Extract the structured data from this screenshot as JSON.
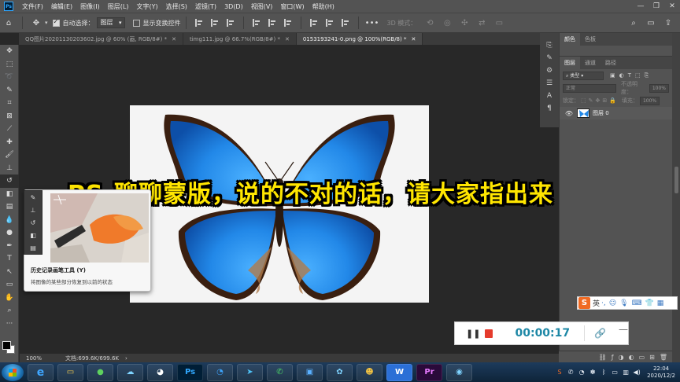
{
  "app": {
    "name": "Photoshop",
    "logo": "Ps"
  },
  "menu": [
    "文件(F)",
    "编辑(E)",
    "图像(I)",
    "图层(L)",
    "文字(Y)",
    "选择(S)",
    "滤镜(T)",
    "3D(D)",
    "视图(V)",
    "窗口(W)",
    "帮助(H)"
  ],
  "options": {
    "auto_select_label": "自动选择：",
    "auto_select_value": "图层",
    "show_transform_label": "显示变换控件",
    "mode_3d_label": "3D 模式："
  },
  "tabs": [
    {
      "label": "QQ图片20201130203602.jpg @ 60% (画, RGB/8#) *",
      "active": false
    },
    {
      "label": "timg111.jpg @ 66.7%(RGB/8#) *",
      "active": false
    },
    {
      "label": "0153193241-0.png @ 100%(RGB/8) *",
      "active": true
    }
  ],
  "overlay_title": "PS-聊聊蒙版，说的不对的话，请大家指出来",
  "tooltip": {
    "title": "历史记录画笔工具 (Y)",
    "desc": "将图像的某些部分恢复到以前的状态"
  },
  "status": {
    "zoom": "100%",
    "doc": "文档:699.6K/699.6K"
  },
  "panels": {
    "top_tabs": [
      "颜色",
      "色板"
    ],
    "layer_tabs": [
      "图层",
      "通道",
      "路径"
    ],
    "kind_label": "类型",
    "blend_mode": "正常",
    "opacity_label": "不透明度：",
    "opacity_value": "100%",
    "lock_label": "锁定：",
    "fill_label": "填充：",
    "fill_value": "100%",
    "layer_name": "图层 0"
  },
  "ime": {
    "lang": "英"
  },
  "recorder": {
    "time": "00:00:17"
  },
  "taskbar": {
    "time": "22:04",
    "date": "2020/12/2",
    "apps": [
      "IE",
      "folder",
      "green",
      "cloud",
      "bot",
      "Ps",
      "edge",
      "feishu",
      "wechat",
      "mail",
      "album",
      "avatar",
      "W",
      "Pr",
      "map"
    ]
  },
  "colors": {
    "overlay_text": "#ffe600",
    "recorder_time": "#1e88a6",
    "stop": "#e53b2c"
  }
}
